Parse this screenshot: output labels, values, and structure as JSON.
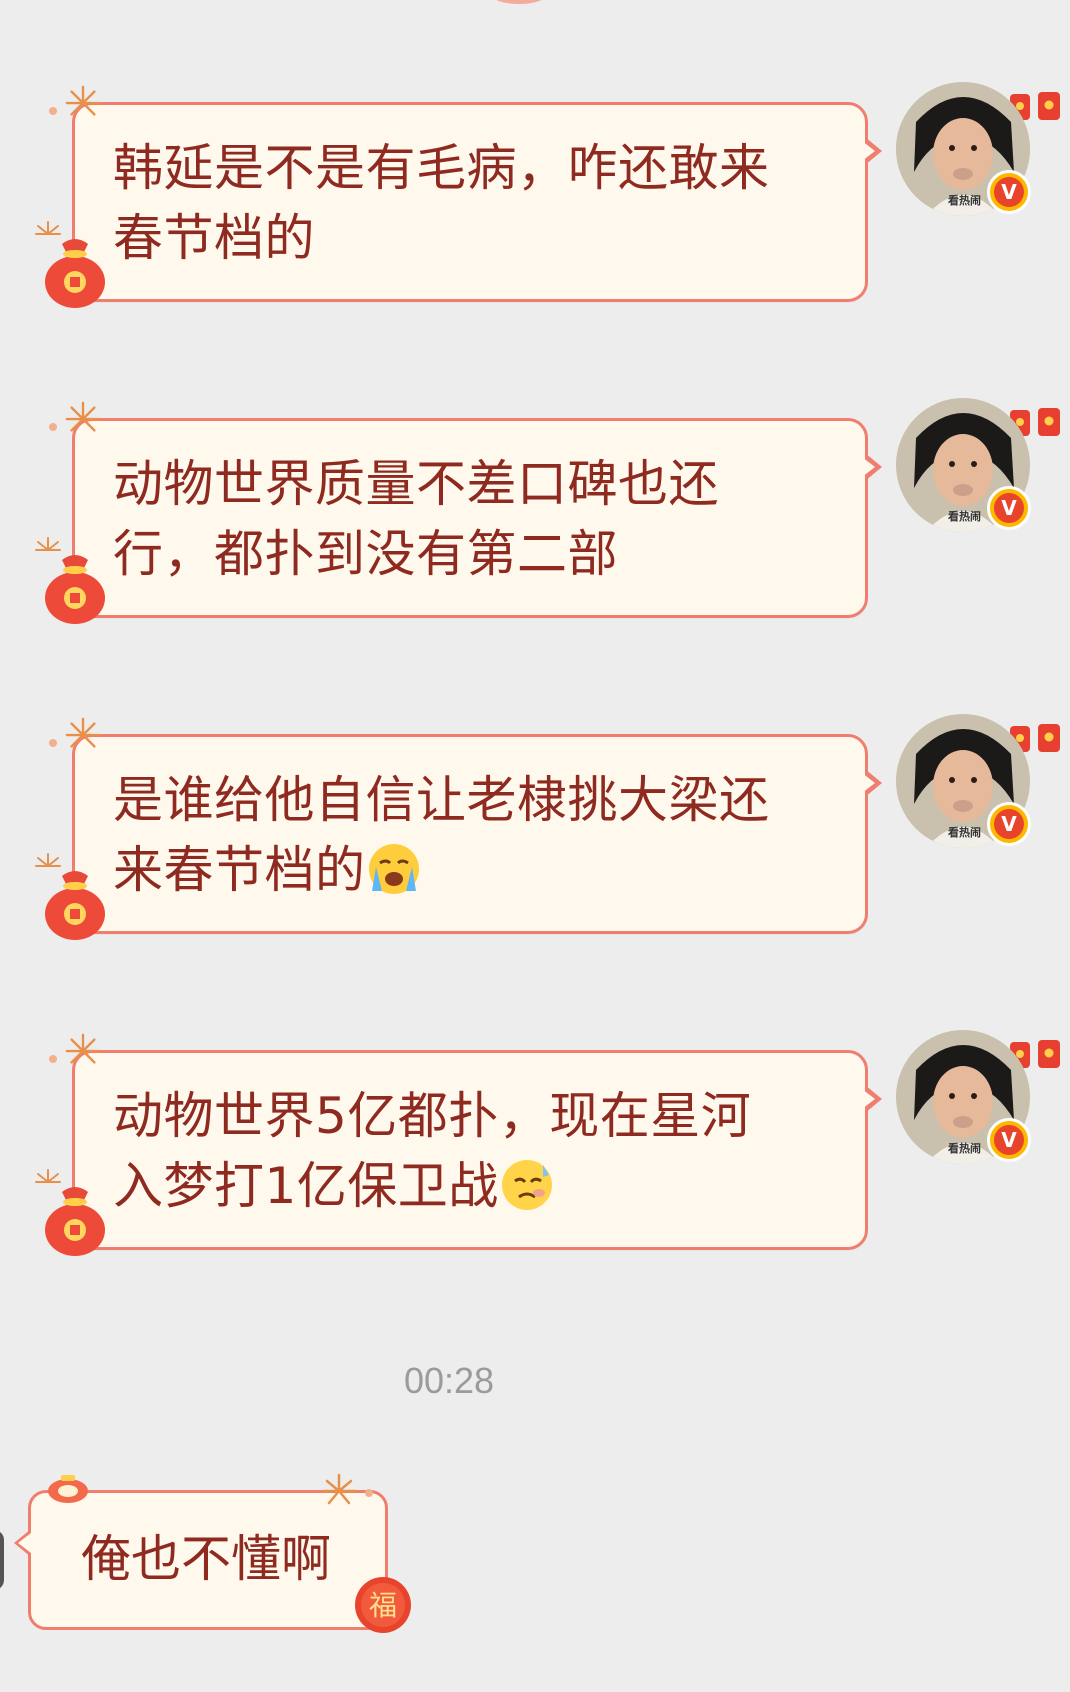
{
  "messages": [
    {
      "text": "韩延是不是有毛病，咋还敢来\n春节档的",
      "emoji": ""
    },
    {
      "text": "动物世界质量不差口碑也还\n行，都扑到没有第二部",
      "emoji": ""
    },
    {
      "text": "是谁给他自信让老棣挑大梁还\n来春节档的",
      "emoji": "crying-face-emoji"
    },
    {
      "text": "动物世界5亿都扑，现在星河\n入梦打1亿保卫战",
      "emoji": "cold-sweat-emoji"
    }
  ],
  "avatar": {
    "tag": "看热闹",
    "badge": "V",
    "badge_color": "#ffb800"
  },
  "timestamp": "00:28",
  "reply": {
    "text": "俺也不懂啊",
    "sticker": "福"
  },
  "colors": {
    "background": "#ededed",
    "bubble_fill": "#fff8ec",
    "bubble_border": "#f07e6f",
    "text": "#8e2a20",
    "timestamp": "#9b9b9b"
  }
}
